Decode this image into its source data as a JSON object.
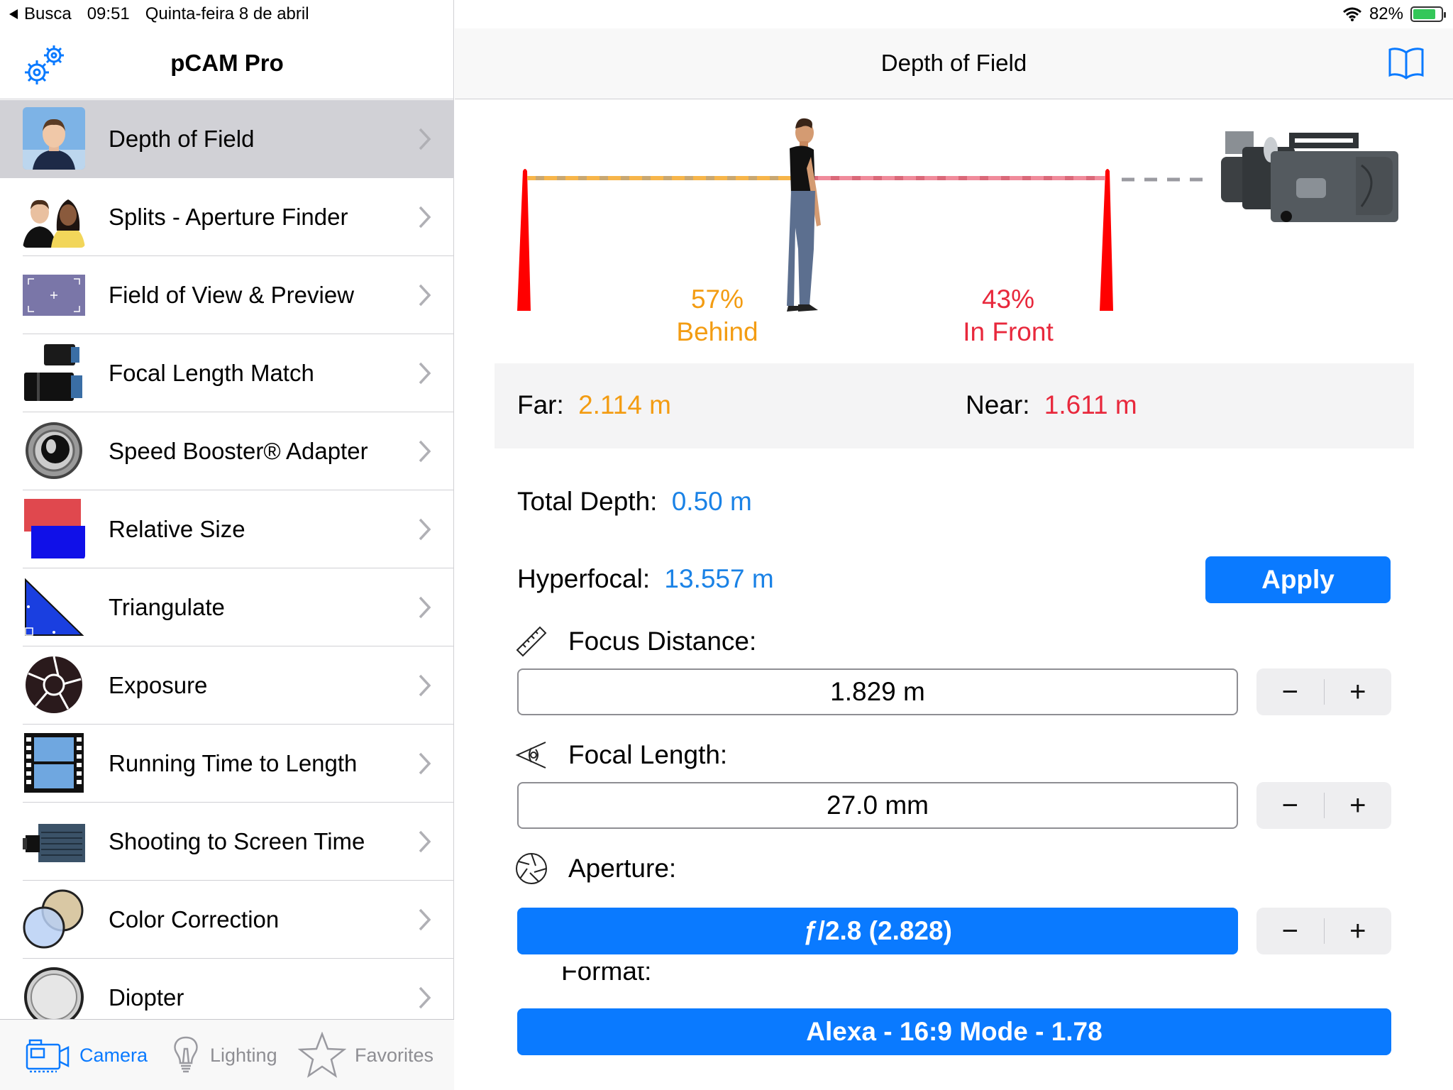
{
  "status_bar": {
    "back_label": "Busca",
    "time": "09:51",
    "date": "Quinta-feira 8 de abril",
    "battery": "82%",
    "battery_level": 0.82
  },
  "sidebar": {
    "title": "pCAM Pro",
    "items": [
      {
        "label": "Depth of Field",
        "selected": true,
        "icon": "person-portrait-icon"
      },
      {
        "label": "Splits - Aperture Finder",
        "icon": "two-people-icon"
      },
      {
        "label": "Field of View & Preview",
        "icon": "viewfinder-icon"
      },
      {
        "label": "Focal Length Match",
        "icon": "lenses-icon"
      },
      {
        "label": "Speed Booster® Adapter",
        "icon": "lens-adapter-icon"
      },
      {
        "label": "Relative Size",
        "icon": "relative-size-icon"
      },
      {
        "label": "Triangulate",
        "icon": "triangle-icon"
      },
      {
        "label": "Exposure",
        "icon": "aperture-icon"
      },
      {
        "label": "Running Time to Length",
        "icon": "film-strip-icon"
      },
      {
        "label": "Shooting to Screen Time",
        "icon": "camera-body-icon"
      },
      {
        "label": "Color Correction",
        "icon": "color-filters-icon"
      },
      {
        "label": "Diopter",
        "icon": "diopter-lens-icon"
      }
    ]
  },
  "tabbar": {
    "tabs": [
      {
        "label": "Camera",
        "active": true,
        "icon": "camera-icon"
      },
      {
        "label": "Lighting",
        "active": false,
        "icon": "lightbulb-icon"
      },
      {
        "label": "Favorites",
        "active": false,
        "icon": "star-icon"
      }
    ]
  },
  "main": {
    "title": "Depth of Field",
    "diagram": {
      "behind_pct": "57%",
      "behind_label": "Behind",
      "front_pct": "43%",
      "front_label": "In Front"
    },
    "far_label": "Far:",
    "far_value": "2.114 m",
    "near_label": "Near:",
    "near_value": "1.611 m",
    "total_depth_label": "Total Depth:",
    "total_depth_value": "0.50 m",
    "hyperfocal_label": "Hyperfocal:",
    "hyperfocal_value": "13.557 m",
    "apply_label": "Apply",
    "focus_distance_label": "Focus Distance:",
    "focus_distance_value": "1.829 m",
    "focal_length_label": "Focal Length:",
    "focal_length_value": "27.0 mm",
    "aperture_label": "Aperture:",
    "aperture_value": "ƒ/2.8 (2.828)",
    "format_label": "Format:",
    "format_value": "Alexa - 16:9 Mode - 1.78",
    "stepper_minus": "−",
    "stepper_plus": "+"
  },
  "colors": {
    "accent": "#0a7aff",
    "behind": "#f39c12",
    "front": "#e8283c",
    "value_blue": "#1a82e6"
  }
}
